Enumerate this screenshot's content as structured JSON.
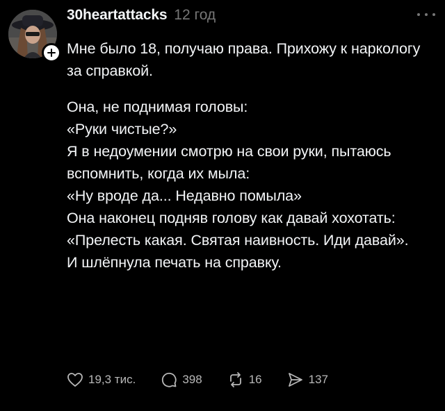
{
  "post": {
    "username": "30heartattacks",
    "time": "12 год",
    "paragraphs": [
      "Мне было 18, получаю права. Прихожу к наркологу за справкой.",
      "Она, не поднимая головы:\n«Руки чистые?»\nЯ в недоумении смотрю на свои руки, пытаюсь вспомнить, когда их мыла:\n«Ну вроде да... Недавно помыла»\nОна наконец подняв голову как давай хохотать:\n«Прелесть какая. Святая наивность. Иди давай».\nИ шлёпнула печать на справку."
    ]
  },
  "actions": {
    "likes": "19,3 тис.",
    "replies": "398",
    "reposts": "16",
    "shares": "137"
  },
  "icons": {
    "avatar": "avatar-photo",
    "follow": "plus-icon",
    "more": "more-dots-icon",
    "like": "heart-icon",
    "reply": "comment-icon",
    "repost": "repost-icon",
    "share": "send-icon"
  },
  "colors": {
    "background": "#000000",
    "text": "#f3f5f7",
    "muted": "#777777",
    "action_text": "#b8b8b8"
  }
}
